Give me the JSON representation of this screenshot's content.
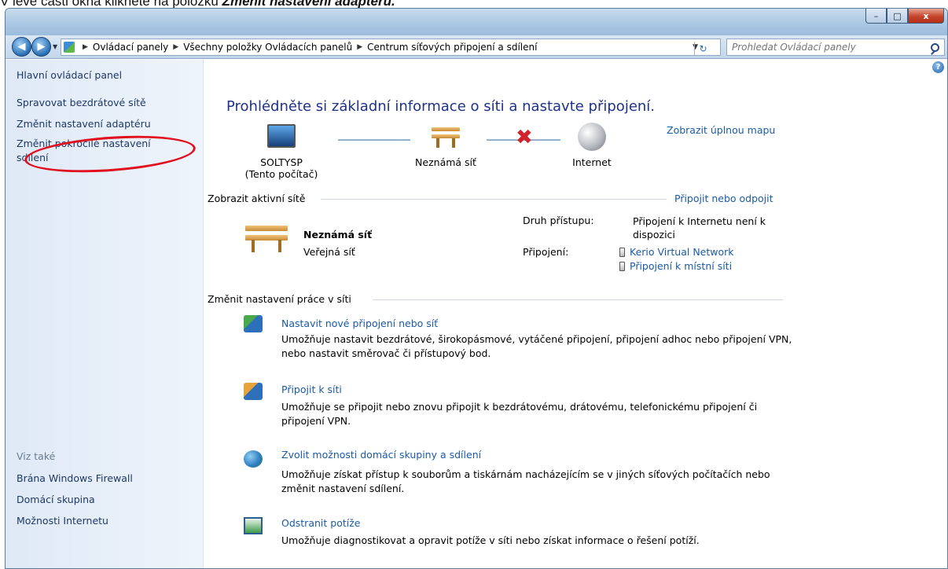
{
  "caption": {
    "prefix": "V levé části okna klikněte na položku ",
    "emphasis": "Změnit nastavení adaptéru."
  },
  "window": {
    "buttons": {
      "minimize": "–",
      "maximize": "□",
      "close": "x"
    }
  },
  "address_bar": {
    "breadcrumb": [
      "Ovládací panely",
      "Všechny položky Ovládacích panelů",
      "Centrum síťových připojení a sdílení"
    ],
    "search_placeholder": "Prohledat Ovládací panely"
  },
  "sidebar": {
    "items": [
      "Hlavní ovládací panel",
      "Spravovat bezdrátové sítě",
      "Změnit nastavení adaptéru",
      "Změnit pokročilé nastavení",
      "sdílení"
    ],
    "see_also_label": "Viz také",
    "see_also": [
      "Brána Windows Firewall",
      "Domácí skupina",
      "Možnosti Internetu"
    ]
  },
  "main": {
    "title": "Prohlédněte si základní informace o síti a nastavte připojení.",
    "full_map_link": "Zobrazit úplnou mapu",
    "map": {
      "computer_name": "SOLTYSP",
      "computer_sub": "(Tento počítač)",
      "network_name": "Neznámá síť",
      "internet_name": "Internet"
    },
    "active_networks": {
      "heading": "Zobrazit aktivní sítě",
      "connect_link": "Připojit nebo odpojit",
      "network_name": "Neznámá síť",
      "network_type": "Veřejná síť",
      "access_type_label": "Druh přístupu:",
      "access_type_value": "Připojení k Internetu není k dispozici",
      "connections_label": "Připojení:",
      "connections": [
        "Kerio Virtual Network",
        "Připojení k místní síti"
      ]
    },
    "change_settings": {
      "heading": "Změnit nastavení práce v síti",
      "tasks": [
        {
          "title": "Nastavit nové připojení nebo síť",
          "desc": "Umožňuje nastavit bezdrátové, širokopásmové, vytáčené připojení, připojení adhoc nebo připojení VPN, nebo nastavit směrovač či přístupový bod."
        },
        {
          "title": "Připojit k síti",
          "desc": "Umožňuje se připojit nebo znovu připojit k bezdrátovému, drátovému, telefonickému připojení či připojení VPN."
        },
        {
          "title": "Zvolit možnosti domácí skupiny a sdílení",
          "desc": "Umožňuje získat přístup k souborům a tiskárnám nacházejícím se v jiných síťových počítačích nebo změnit nastavení sdílení."
        },
        {
          "title": "Odstranit potíže",
          "desc": "Umožňuje diagnostikovat a opravit potíže v síti nebo získat informace o řešení potíží."
        }
      ]
    }
  }
}
